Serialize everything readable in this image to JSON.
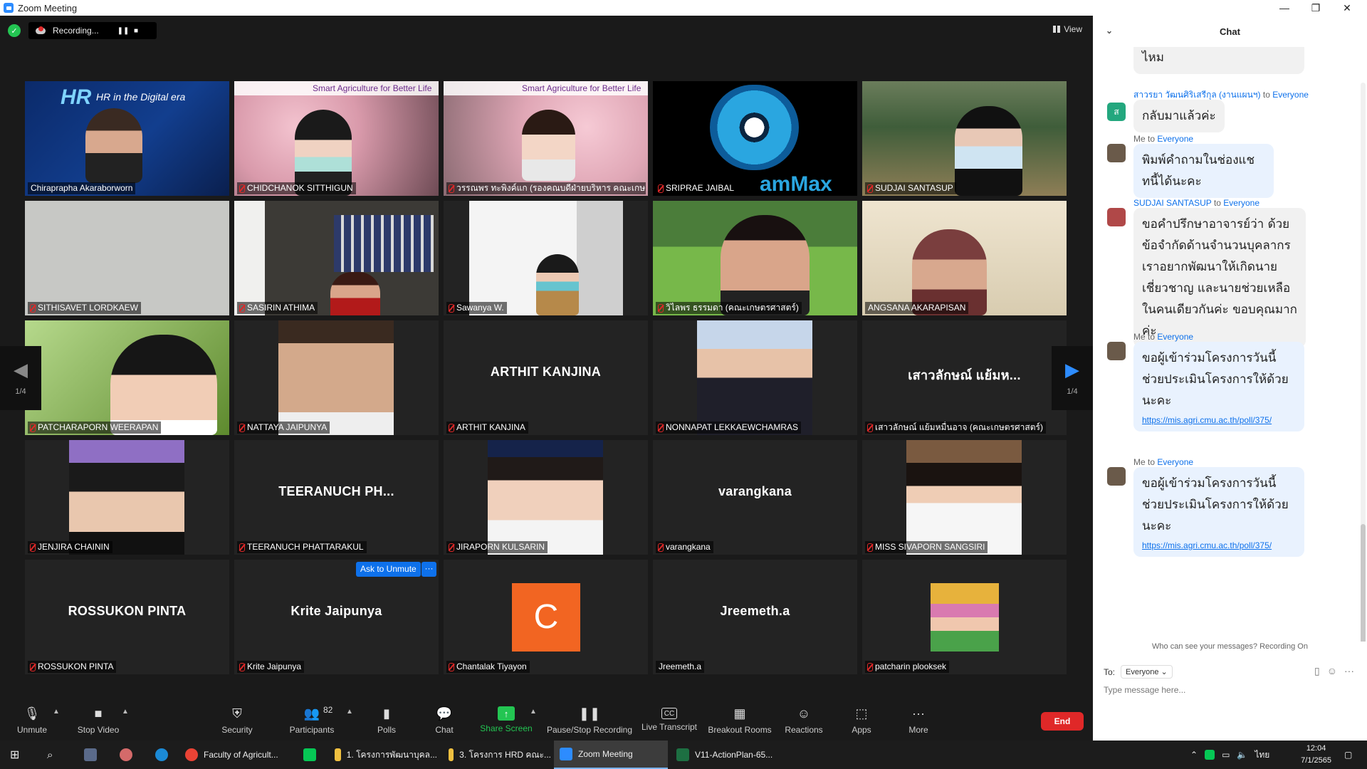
{
  "window": {
    "title": "Zoom Meeting",
    "minimize": "—",
    "maximize": "❐",
    "close": "✕"
  },
  "topbar": {
    "recording_label": "Recording...",
    "pause": "❚❚",
    "stop": "■",
    "view_label": "View"
  },
  "tiles": [
    {
      "name": "Chiraprapha Akaraborworn",
      "overlay": "HR in the Digital era",
      "kind": "video",
      "mic": "plain"
    },
    {
      "name": "CHIDCHANOK SITTHIGUN",
      "overlay": "Smart Agriculture for Better Life",
      "kind": "video"
    },
    {
      "name": "วรรณพร ทะพิงค์แก (รองคณบดีฝ่ายบริหาร คณะเกษ...",
      "overlay": "Smart Agriculture for Better Life",
      "kind": "video"
    },
    {
      "name": "SRIPRAE JAIBAL",
      "overlay": "amMax",
      "kind": "video"
    },
    {
      "name": "SUDJAI SANTASUP",
      "kind": "video"
    },
    {
      "name": "SITHISAVET LORDKAEW",
      "kind": "video"
    },
    {
      "name": "SASIRIN ATHIMA",
      "kind": "video"
    },
    {
      "name": "Sawanya W.",
      "kind": "video"
    },
    {
      "name": "วิไลพร ธรรมดา (คณะเกษตรศาสตร์)",
      "kind": "video"
    },
    {
      "name": "ANGSANA AKARAPISAN",
      "kind": "video",
      "active": true
    },
    {
      "name": "PATCHARAPORN WEERAPAN",
      "kind": "video"
    },
    {
      "name": "NATTAYA JAIPUNYA",
      "kind": "photo"
    },
    {
      "name": "ARTHIT KANJINA",
      "big": "ARTHIT KANJINA",
      "kind": "name"
    },
    {
      "name": "NONNAPAT LEKKAEWCHAMRAS",
      "kind": "photo"
    },
    {
      "name": "เสาวลักษณ์ แย้มหมื่นอาจ (คณะเกษตรศาสตร์)",
      "big": "เสาวลักษณ์ แย้มห...",
      "kind": "name"
    },
    {
      "name": "JENJIRA CHAININ",
      "kind": "photo"
    },
    {
      "name": "TEERANUCH PHATTARAKUL",
      "big": "TEERANUCH  PH...",
      "kind": "name"
    },
    {
      "name": "JIRAPORN KULSARIN",
      "kind": "photo"
    },
    {
      "name": "varangkana",
      "big": "varangkana",
      "kind": "name"
    },
    {
      "name": "MISS SIVAPORN SANGSIRI",
      "kind": "photo"
    },
    {
      "name": "ROSSUKON PINTA",
      "big": "ROSSUKON PINTA",
      "kind": "name"
    },
    {
      "name": "Krite Jaipunya",
      "big": "Krite Jaipunya",
      "kind": "name"
    },
    {
      "name": "Chantalak Tiyayon",
      "initial": "C",
      "kind": "initial"
    },
    {
      "name": "Jreemeth.a",
      "big": "Jreemeth.a",
      "kind": "name",
      "mic": "plain"
    },
    {
      "name": "patcharin plooksek",
      "kind": "photo"
    }
  ],
  "ask_unmute": {
    "label": "Ask to Unmute",
    "more": "···"
  },
  "pager": {
    "left": "1/4",
    "right": "1/4"
  },
  "toolbar": {
    "unmute": "Unmute",
    "stop_video": "Stop Video",
    "security": "Security",
    "participants": "Participants",
    "participants_count": "82",
    "polls": "Polls",
    "chat": "Chat",
    "share_screen": "Share Screen",
    "pause_stop_recording": "Pause/Stop Recording",
    "live_transcript": "Live Transcript",
    "breakout_rooms": "Breakout Rooms",
    "reactions": "Reactions",
    "apps": "Apps",
    "more": "More",
    "end": "End",
    "cc": "CC"
  },
  "chat": {
    "title": "Chat",
    "messages": [
      {
        "from": "",
        "to": "",
        "text": "ไหม",
        "style": "grey"
      },
      {
        "from": "สาวรยา วัฒนศิริเสรีกุล (งานแผนฯ)",
        "to": "Everyone",
        "text": "กลับมาแล้วค่ะ",
        "style": "grey",
        "avatar": "ส"
      },
      {
        "from": "Me",
        "to": "Everyone",
        "text": "พิมพ์คำถามในช่องแชทนี้ได้นะคะ",
        "style": "blue"
      },
      {
        "from": "SUDJAI SANTASUP",
        "to": "Everyone",
        "text": "ขอคำปรึกษาอาจารย์ว่า ด้วยข้อจำกัดด้านจำนวนบุคลากร เราอยากพัฒนาให้เกิดนายเชี่ยวชาญ และนายช่วยเหลือ ในคนเดียวกันค่ะ ขอบคุณมากค่ะ",
        "style": "grey"
      },
      {
        "from": "Me",
        "to": "Everyone",
        "text": "ขอผู้เข้าร่วมโครงการวันนี้ช่วยประเมินโครงการให้ด้วยนะคะ",
        "link": "https://mis.agri.cmu.ac.th/poll/375/",
        "style": "blue"
      },
      {
        "from": "Me",
        "to": "Everyone",
        "text": "ขอผู้เข้าร่วมโครงการวันนี้ช่วยประเมินโครงการให้ด้วยนะคะ",
        "link": "https://mis.agri.cmu.ac.th/poll/375/",
        "style": "blue"
      }
    ],
    "to_word": "to",
    "note": "Who can see your messages? Recording On",
    "to_label": "To:",
    "recipient": "Everyone",
    "placeholder": "Type message here..."
  },
  "taskbar": {
    "items": [
      {
        "label": "Faculty of Agricult...",
        "color": "#ea4335"
      },
      {
        "label": "1. โครงการพัฒนาบุคล...",
        "color": "#f0c040"
      },
      {
        "label": "3. โครงการ HRD คณะ...",
        "color": "#f0c040"
      },
      {
        "label": "Zoom Meeting",
        "color": "#2d8cff",
        "active": true
      },
      {
        "label": "V11-ActionPlan-65...",
        "color": "#1d6f42"
      }
    ],
    "lang": "ไทย",
    "time": "12:04",
    "date": "7/1/2565"
  },
  "colors": {
    "accent": "#2d8cff",
    "end": "#e02828",
    "share": "#23c552",
    "active_speaker": "#e8e178"
  }
}
